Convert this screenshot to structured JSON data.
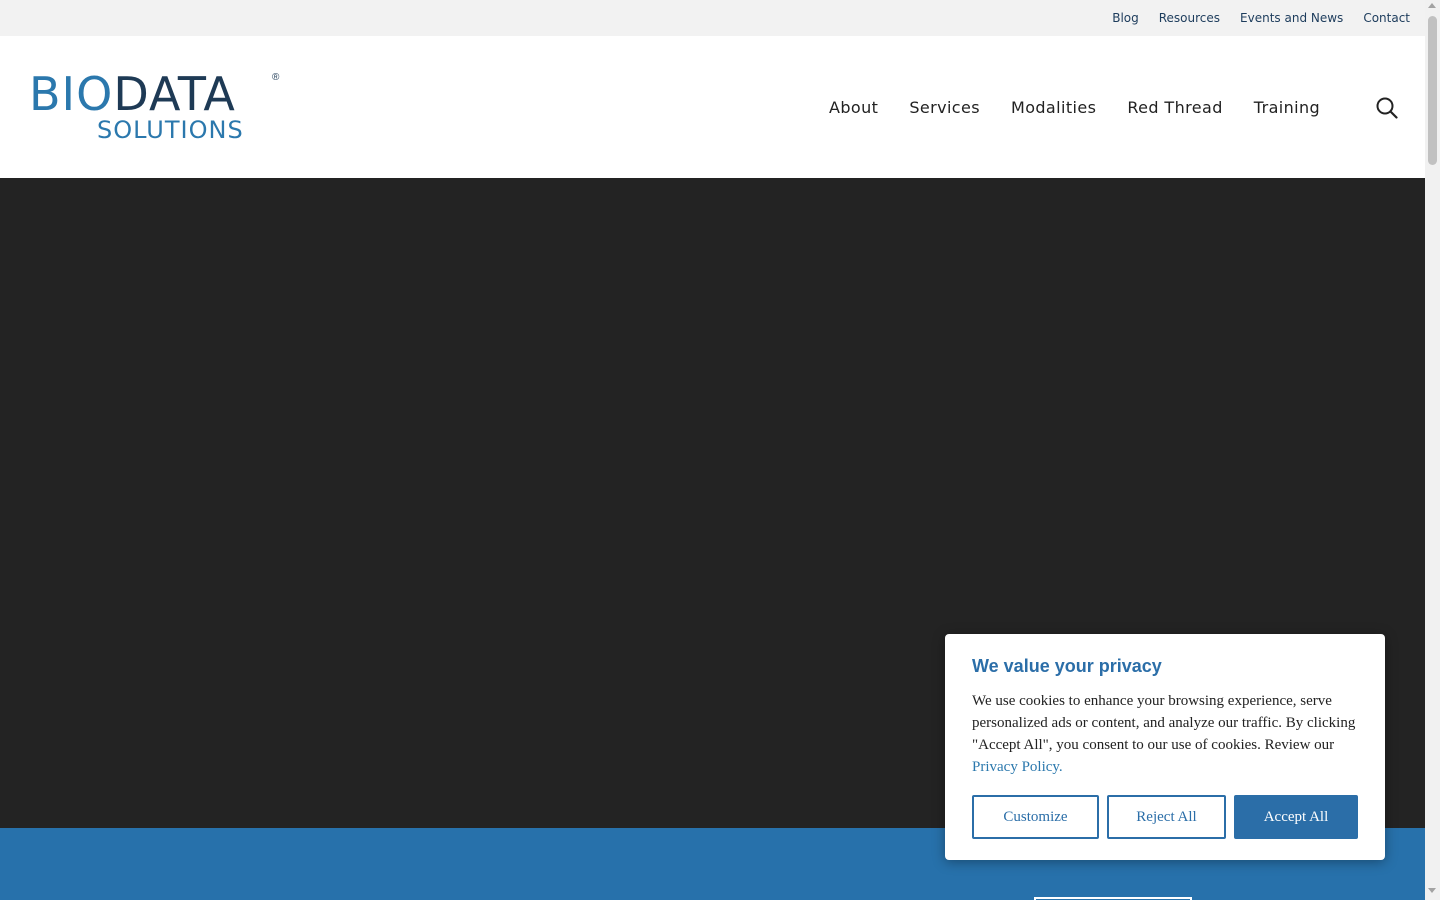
{
  "utility_nav": {
    "items": [
      {
        "label": "Blog"
      },
      {
        "label": "Resources"
      },
      {
        "label": "Events and News"
      },
      {
        "label": "Contact"
      }
    ]
  },
  "logo": {
    "bio": "BIO",
    "data": "DATA",
    "registered": "®",
    "subtitle": "SOLUTIONS",
    "colors": {
      "primary": "#2b78ad",
      "dark": "#1e3a55"
    }
  },
  "main_nav": {
    "items": [
      {
        "label": "About"
      },
      {
        "label": "Services"
      },
      {
        "label": "Modalities"
      },
      {
        "label": "Red Thread"
      },
      {
        "label": "Training"
      }
    ],
    "search_icon": "search-icon"
  },
  "hero": {
    "background": "#232323"
  },
  "cta_band": {
    "background": "#2771ab"
  },
  "cookie_banner": {
    "title": "We value your privacy",
    "body": "We use cookies to enhance your browsing experience, serve personalized ads or content, and analyze our traffic. By clicking \"Accept All\", you consent to our use of cookies. Review our ",
    "link_label": "Privacy Policy.",
    "buttons": {
      "customize": "Customize",
      "reject": "Reject All",
      "accept": "Accept All"
    },
    "accent": "#2b6ea8"
  }
}
